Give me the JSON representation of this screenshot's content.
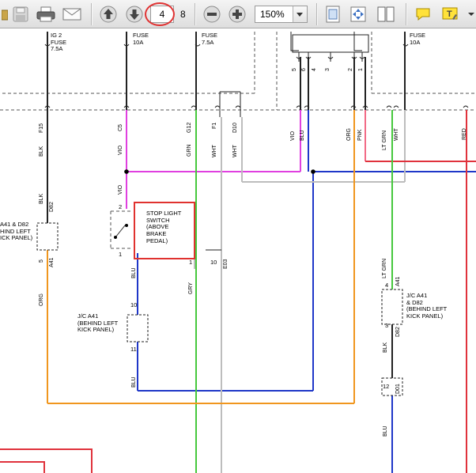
{
  "toolbar": {
    "icons": [
      "open-folder-icon",
      "save-icon",
      "print-icon",
      "email-icon",
      "previous-page-icon",
      "next-page-icon",
      "zoom-out-icon",
      "zoom-in-icon",
      "fit-page-icon",
      "full-screen-icon",
      "two-page-icon",
      "comment-icon",
      "highlight-icon"
    ],
    "current_page": "4",
    "page_count": "8",
    "zoom": "150%",
    "highlight_color": "#e03333"
  },
  "diagram": {
    "fuses": [
      {
        "line1": "IG 2",
        "line2": "FUSE",
        "line3": "7.5A"
      },
      {
        "line1": "FUSE",
        "line2": "10A"
      },
      {
        "line1": "FUSE",
        "line2": "7.5A"
      },
      {
        "line1": "FUSE",
        "line2": "10A"
      }
    ],
    "connector_pins_top": [
      "5",
      "6",
      "4",
      "3",
      "2",
      "1"
    ],
    "pin_labels": {
      "f15": "F15",
      "c5": "C5",
      "g12": "G12",
      "f1": "F1",
      "d10": "D10",
      "blk1": "BLK",
      "vio1": "VIO",
      "grn1": "GRN",
      "wht1": "WHT",
      "wht2": "WHT",
      "vio2": "VIO",
      "blu1": "BLU",
      "org1": "ORG",
      "pnk": "PNK",
      "ltgrn1": "LT GRN",
      "wht3": "WHT",
      "red": "RED"
    },
    "left_connector": {
      "lines": "A41 & D82\nHIND LEFT\nICK PANEL)",
      "pin_top": "D82",
      "pin_top_num": "",
      "wire_top": "BLK",
      "pin_bottom": "A41",
      "pin_bottom_num": "5",
      "wire_bottom": "ORG"
    },
    "stop_switch": {
      "label": "STOP LIGHT\nSWITCH\n(ABOVE\nBRAKE\nPEDAL)",
      "wire_in": "VIO",
      "pin_in": "2",
      "pin_out": "1",
      "wire_out": "BLU"
    },
    "jc_a41_mid": {
      "label": "J/C A41\n(BEHIND LEFT\nKICK PANEL)",
      "pin_top": "10",
      "pin_bottom": "11",
      "wire_bottom": "BLU"
    },
    "jc_right": {
      "label": "J/C A41\n& D82\n(BEHIND LEFT\nKICK PANEL)",
      "pin_top": "4",
      "conn_top": "A41",
      "wire_top": "LT GRN",
      "pin_bottom": "3",
      "conn_bottom": "D82",
      "wire_bottom": "BLK",
      "pin_lower": "12",
      "conn_lower": "D01",
      "wire_lower": "BLU"
    },
    "grey_conn": {
      "pin_a": "1",
      "pin_b": "10",
      "conn": "E03",
      "wire": "GRY"
    },
    "colors": {
      "black": "#222222",
      "violet": "#e040e0",
      "green": "#46c83c",
      "white_wire": "#bdbdbd",
      "blue": "#1f37c8",
      "orange": "#f0961e",
      "pink": "#f26b86",
      "red": "#e0323c",
      "dashed": "#555555"
    }
  }
}
